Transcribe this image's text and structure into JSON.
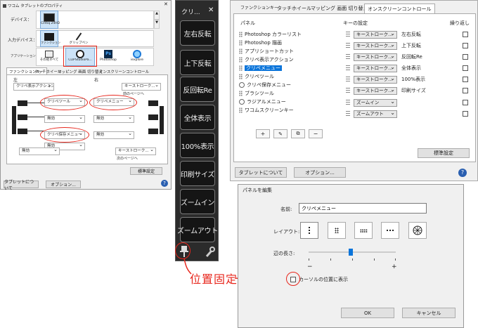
{
  "wacom_window": {
    "title": "ワコム タブレットのプロパティ",
    "device_label": "デバイス：",
    "device_name": "Cintiq 24HD",
    "input_label": "入力デバイス：",
    "input_functions": "ファンクション",
    "input_pen": "グリップペン",
    "app_label": "アプリケーション：",
    "apps": [
      "その他すべて",
      "CLIPStudioPa...",
      "Photoshop",
      "iexplore"
    ],
    "tabs": [
      "ファンクションキー",
      "タッチホイール",
      "マッピング 画面 切り替え",
      "オンスクリーンコントロール"
    ],
    "left_header": "左",
    "right_header": "右",
    "left_keys": [
      "クリペ表示アクション",
      "クリペツール",
      "無効",
      "クリペ保存メニュー",
      "無効",
      "無効"
    ],
    "right_keys": [
      "キーストローク...",
      "クリペメニュー",
      "無効",
      "無効",
      "キーストローク..."
    ],
    "right_note_top": "前のページへ",
    "right_note_bottom": "次のページへ",
    "default_button": "標準設定",
    "about_button": "タブレットについて",
    "options_button": "オプション...",
    "help": "?"
  },
  "toolbar": {
    "title": "クリ...",
    "close": "✕",
    "buttons": [
      "左右反転",
      "上下反転",
      "反回転Re",
      "全体表示",
      "100%表示",
      "印刷サイズ",
      "ズームイン",
      "ズームアウト"
    ],
    "pin_icon": "pin-icon",
    "settings_icon": "wrench-icon"
  },
  "onscreen_panel": {
    "tabs": [
      "ファンクションキー",
      "タッチホイール",
      "マッピング 画面 切り替え",
      "オンスクリーンコントロール"
    ],
    "panel_header": "パネル",
    "key_header": "キーの設定",
    "repeat_header": "繰り返し",
    "items": [
      "Photoshop カラーリスト",
      "Photoshop 描画",
      "アプリショートカット",
      "クリペ表示アクション",
      "クリペメニュー",
      "クリペツール",
      "クリペ保存メニュー",
      "ブラシツール",
      "ラジアルメニュー",
      "ワコムスクリーンキー"
    ],
    "selected_index": 4,
    "keys": [
      "キーストローク...",
      "キーストローク...",
      "キーストローク...",
      "キーストローク...",
      "キーストローク...",
      "キーストローク...",
      "ズームイン",
      "ズームアウト"
    ],
    "key_labels": [
      "左右反転",
      "上下反転",
      "反回転Re",
      "全体表示",
      "100%表示",
      "印刷サイズ"
    ],
    "toolbar_buttons": [
      "+",
      "✎",
      "⧉",
      "−"
    ],
    "default_button": "標準設定",
    "about_button": "タブレットについて",
    "options_button": "オプション...",
    "help": "?"
  },
  "edit_dialog": {
    "title": "パネルを編集",
    "name_label": "名前:",
    "name_value": "クリペメニュー",
    "layout_label": "レイアウト:",
    "length_label": "辺の長さ:",
    "minus": "−",
    "plus": "+",
    "slider_value": 0.4,
    "cursor_checkbox_label": "カーソルの位置に表示",
    "ok_button": "OK",
    "cancel_button": "キャンセル"
  },
  "annotation": {
    "text": "位置固定"
  },
  "colors": {
    "accent": "#0a74da",
    "annotation": "#e8271d",
    "toolbar_bg": "#2b2b2b"
  }
}
